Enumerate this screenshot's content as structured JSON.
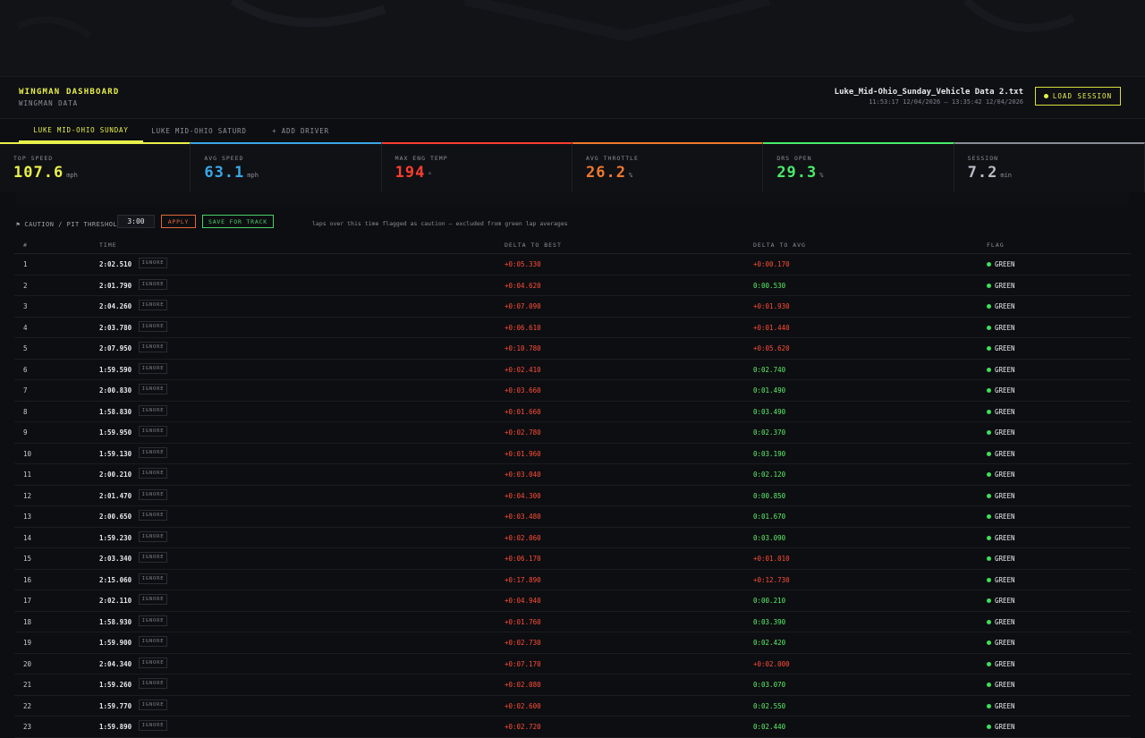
{
  "app": {
    "title": "WINGMAN DASHBOARD",
    "subtitle": "WINGMAN DATA"
  },
  "session": {
    "file": "Luke_Mid-Ohio_Sunday_Vehicle Data 2.txt",
    "range": "11:53:17 12/04/2026 – 13:35:42 12/04/2026",
    "load_label": "LOAD SESSION"
  },
  "tabs": [
    {
      "label": "LUKE MID-OHIO SUNDAY",
      "active": true
    },
    {
      "label": "LUKE MID-OHIO SATURD",
      "active": false
    },
    {
      "label": "+ ADD DRIVER",
      "active": false
    }
  ],
  "stats": [
    {
      "label": "TOP SPEED",
      "value": "107.6",
      "unit": "mph",
      "color": "#e8f04a"
    },
    {
      "label": "AVG SPEED",
      "value": "63.1",
      "unit": "mph",
      "color": "#3aa8e8"
    },
    {
      "label": "MAX ENG TEMP",
      "value": "194",
      "unit": "°",
      "color": "#ff3d2e"
    },
    {
      "label": "AVG THROTTLE",
      "value": "26.2",
      "unit": "%",
      "color": "#f0782e"
    },
    {
      "label": "DRS OPEN",
      "value": "29.3",
      "unit": "%",
      "color": "#4aec6a"
    },
    {
      "label": "SESSION",
      "value": "7.2",
      "unit": "min",
      "color": "#b8bcc4"
    }
  ],
  "threshold": {
    "label": "⚑ CAUTION / PIT THRESHOLD:",
    "value": "3:00",
    "apply_label": "APPLY",
    "save_label": "SAVE FOR TRACK",
    "note": "laps over this time flagged as caution — excluded from green lap averages"
  },
  "table": {
    "headers": {
      "num": "#",
      "time": "TIME",
      "delta_best": "DELTA TO BEST",
      "delta_avg": "DELTA TO AVG",
      "flag": "FLAG"
    },
    "ignore_label": "IGNORE",
    "rows": [
      {
        "num": "1",
        "time": "2:02.510",
        "delta_best": "+0:05.330",
        "delta_avg": "+0:00.170",
        "avg_sign": "pos",
        "flag": "GREEN"
      },
      {
        "num": "2",
        "time": "2:01.790",
        "delta_best": "+0:04.620",
        "delta_avg": "0:00.530",
        "avg_sign": "neg",
        "flag": "GREEN"
      },
      {
        "num": "3",
        "time": "2:04.260",
        "delta_best": "+0:07.090",
        "delta_avg": "+0:01.930",
        "avg_sign": "pos",
        "flag": "GREEN"
      },
      {
        "num": "4",
        "time": "2:03.780",
        "delta_best": "+0:06.610",
        "delta_avg": "+0:01.440",
        "avg_sign": "pos",
        "flag": "GREEN"
      },
      {
        "num": "5",
        "time": "2:07.950",
        "delta_best": "+0:10.780",
        "delta_avg": "+0:05.620",
        "avg_sign": "pos",
        "flag": "GREEN"
      },
      {
        "num": "6",
        "time": "1:59.590",
        "delta_best": "+0:02.410",
        "delta_avg": "0:02.740",
        "avg_sign": "neg",
        "flag": "GREEN"
      },
      {
        "num": "7",
        "time": "2:00.830",
        "delta_best": "+0:03.660",
        "delta_avg": "0:01.490",
        "avg_sign": "neg",
        "flag": "GREEN"
      },
      {
        "num": "8",
        "time": "1:58.830",
        "delta_best": "+0:01.660",
        "delta_avg": "0:03.490",
        "avg_sign": "neg",
        "flag": "GREEN"
      },
      {
        "num": "9",
        "time": "1:59.950",
        "delta_best": "+0:02.780",
        "delta_avg": "0:02.370",
        "avg_sign": "neg",
        "flag": "GREEN"
      },
      {
        "num": "10",
        "time": "1:59.130",
        "delta_best": "+0:01.960",
        "delta_avg": "0:03.190",
        "avg_sign": "neg",
        "flag": "GREEN"
      },
      {
        "num": "11",
        "time": "2:00.210",
        "delta_best": "+0:03.040",
        "delta_avg": "0:02.120",
        "avg_sign": "neg",
        "flag": "GREEN"
      },
      {
        "num": "12",
        "time": "2:01.470",
        "delta_best": "+0:04.300",
        "delta_avg": "0:00.850",
        "avg_sign": "neg",
        "flag": "GREEN"
      },
      {
        "num": "13",
        "time": "2:00.650",
        "delta_best": "+0:03.480",
        "delta_avg": "0:01.670",
        "avg_sign": "neg",
        "flag": "GREEN"
      },
      {
        "num": "14",
        "time": "1:59.230",
        "delta_best": "+0:02.060",
        "delta_avg": "0:03.090",
        "avg_sign": "neg",
        "flag": "GREEN"
      },
      {
        "num": "15",
        "time": "2:03.340",
        "delta_best": "+0:06.170",
        "delta_avg": "+0:01.010",
        "avg_sign": "pos",
        "flag": "GREEN"
      },
      {
        "num": "16",
        "time": "2:15.060",
        "delta_best": "+0:17.890",
        "delta_avg": "+0:12.730",
        "avg_sign": "pos",
        "flag": "GREEN"
      },
      {
        "num": "17",
        "time": "2:02.110",
        "delta_best": "+0:04.940",
        "delta_avg": "0:00.210",
        "avg_sign": "neg",
        "flag": "GREEN"
      },
      {
        "num": "18",
        "time": "1:58.930",
        "delta_best": "+0:01.760",
        "delta_avg": "0:03.390",
        "avg_sign": "neg",
        "flag": "GREEN"
      },
      {
        "num": "19",
        "time": "1:59.900",
        "delta_best": "+0:02.730",
        "delta_avg": "0:02.420",
        "avg_sign": "neg",
        "flag": "GREEN"
      },
      {
        "num": "20",
        "time": "2:04.340",
        "delta_best": "+0:07.170",
        "delta_avg": "+0:02.000",
        "avg_sign": "pos",
        "flag": "GREEN"
      },
      {
        "num": "21",
        "time": "1:59.260",
        "delta_best": "+0:02.080",
        "delta_avg": "0:03.070",
        "avg_sign": "neg",
        "flag": "GREEN"
      },
      {
        "num": "22",
        "time": "1:59.770",
        "delta_best": "+0:02.600",
        "delta_avg": "0:02.550",
        "avg_sign": "neg",
        "flag": "GREEN"
      },
      {
        "num": "23",
        "time": "1:59.890",
        "delta_best": "+0:02.720",
        "delta_avg": "0:02.440",
        "avg_sign": "neg",
        "flag": "GREEN"
      }
    ]
  },
  "colors": {
    "accent": "#e8f04a",
    "caution": "#e0673a",
    "positive_delta": "#ff4d3a",
    "negative_delta": "#5bf06a",
    "flag_green": "#3ee05a"
  }
}
